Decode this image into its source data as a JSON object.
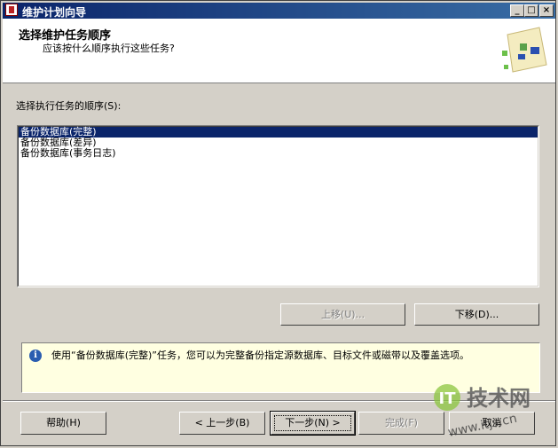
{
  "window": {
    "title": "维护计划向导",
    "buttons": {
      "minimize": "_",
      "maximize": "□",
      "close": "×"
    }
  },
  "header": {
    "title": "选择维护任务顺序",
    "subtitle": "应该按什么顺序执行这些任务?"
  },
  "order_label": "选择执行任务的顺序(S):",
  "tasks": [
    "备份数据库(完整)",
    "备份数据库(差异)",
    "备份数据库(事务日志)"
  ],
  "selected_task_index": 0,
  "move_buttons": {
    "up": "上移(U)...",
    "down": "下移(D)..."
  },
  "info": "使用“备份数据库(完整)”任务，您可以为完整备份指定源数据库、目标文件或磁带以及覆盖选项。",
  "footer": {
    "help": "帮助(H)",
    "back": "< 上一步(B)",
    "next": "下一步(N) >",
    "finish": "完成(F)",
    "cancel": "取消"
  },
  "watermark": {
    "main": "技术网",
    "url": "www.itjs.cn"
  }
}
